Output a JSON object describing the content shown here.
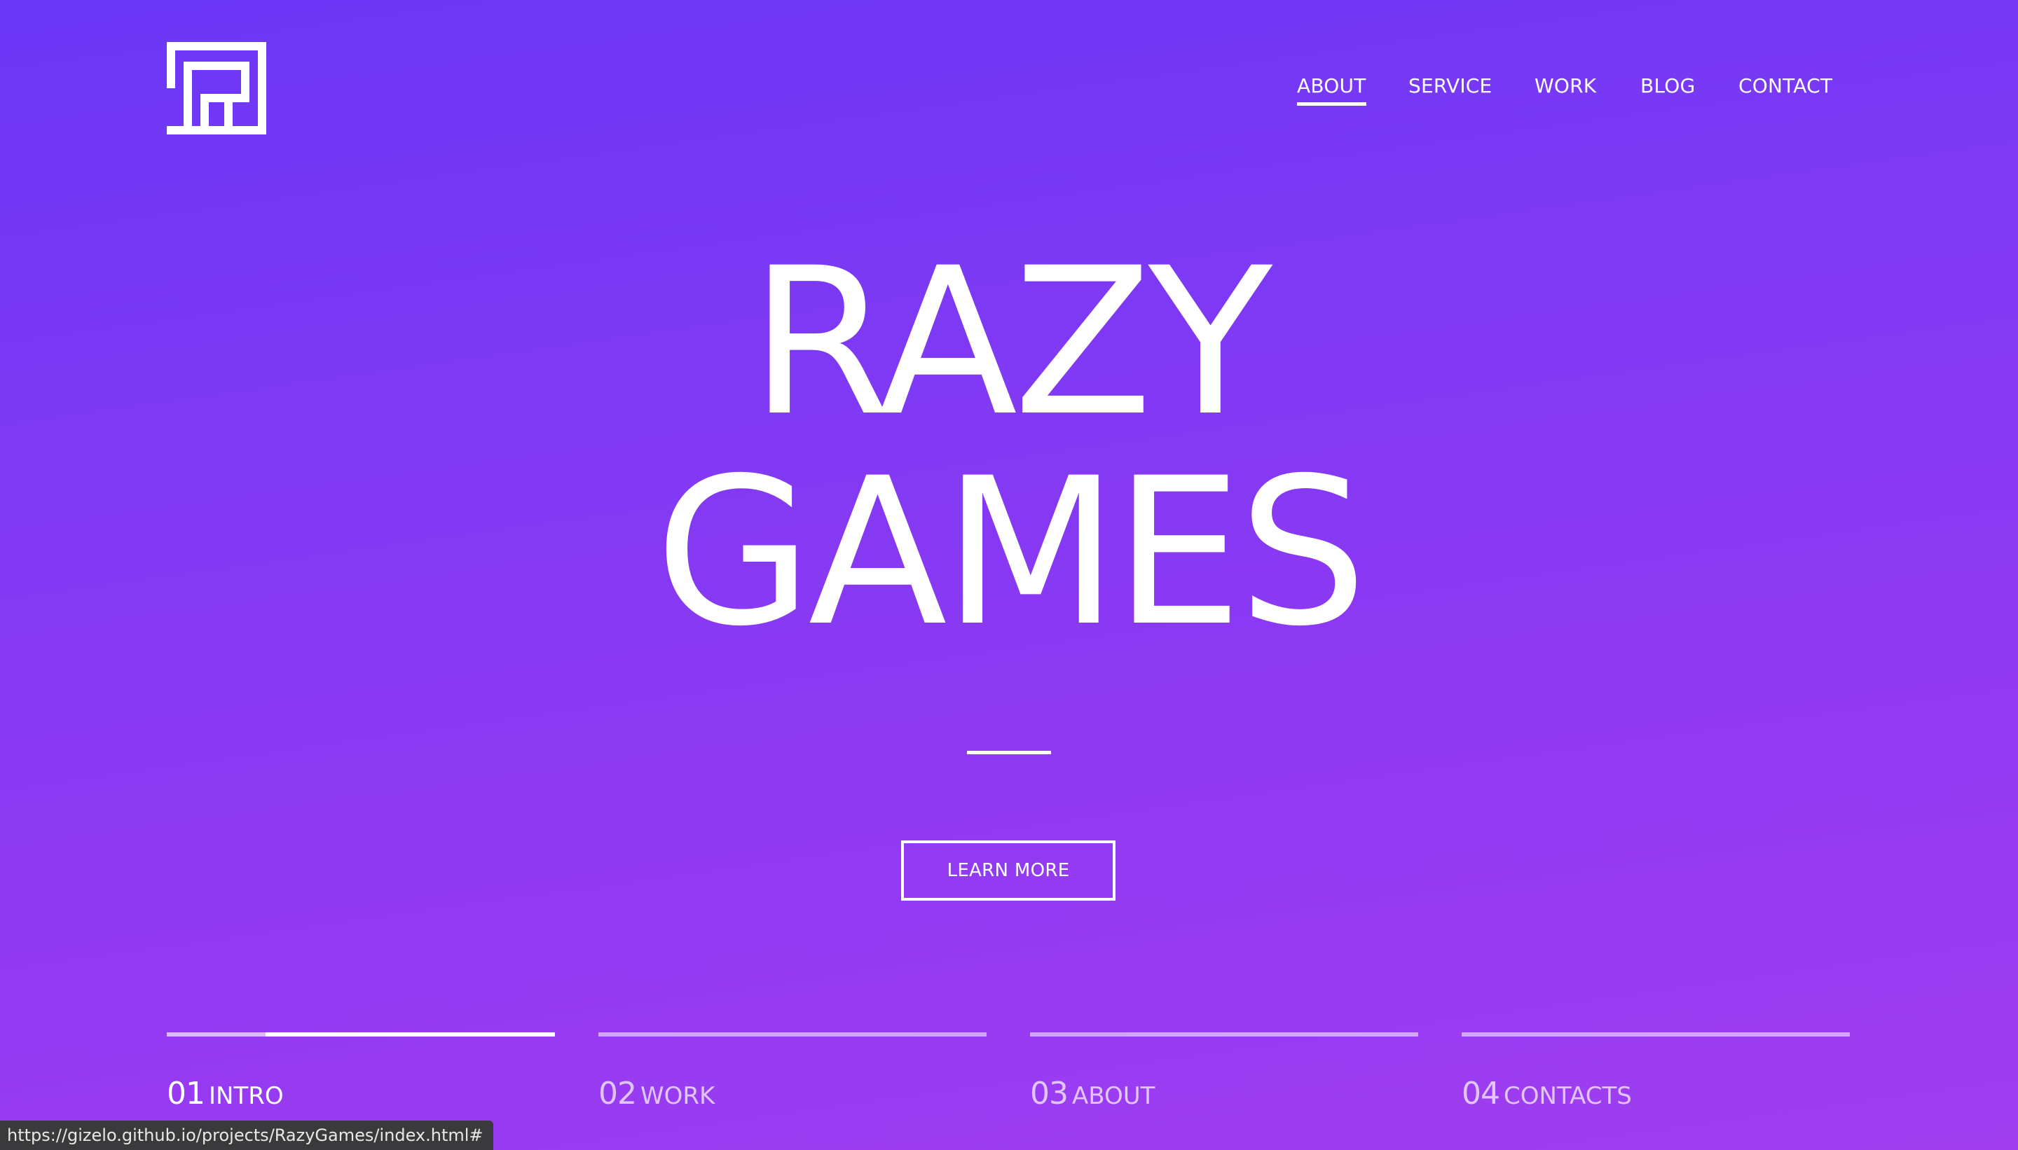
{
  "brand": {
    "logo_icon": "razy-r-logo-icon"
  },
  "nav": {
    "items": [
      {
        "label": "ABOUT",
        "active": true
      },
      {
        "label": "SERVICE",
        "active": false
      },
      {
        "label": "WORK",
        "active": false
      },
      {
        "label": "BLOG",
        "active": false
      },
      {
        "label": "CONTACT",
        "active": false
      }
    ]
  },
  "hero": {
    "title_line1": "RAZY",
    "title_line2": "GAMES",
    "cta_label": "LEARN MORE"
  },
  "sections": [
    {
      "number": "01",
      "name": "INTRO",
      "active": true,
      "progress": 0.25
    },
    {
      "number": "02",
      "name": "WORK",
      "active": false,
      "progress": 1.0
    },
    {
      "number": "03",
      "name": "ABOUT",
      "active": false,
      "progress": 1.0
    },
    {
      "number": "04",
      "name": "CONTACTS",
      "active": false,
      "progress": 1.0
    }
  ],
  "status_bar": {
    "url": "https://gizelo.github.io/projects/RazyGames/index.html#"
  },
  "colors": {
    "background_top": "#6a37f6",
    "background_bottom": "#a03ef0",
    "foreground": "#ffffff"
  }
}
